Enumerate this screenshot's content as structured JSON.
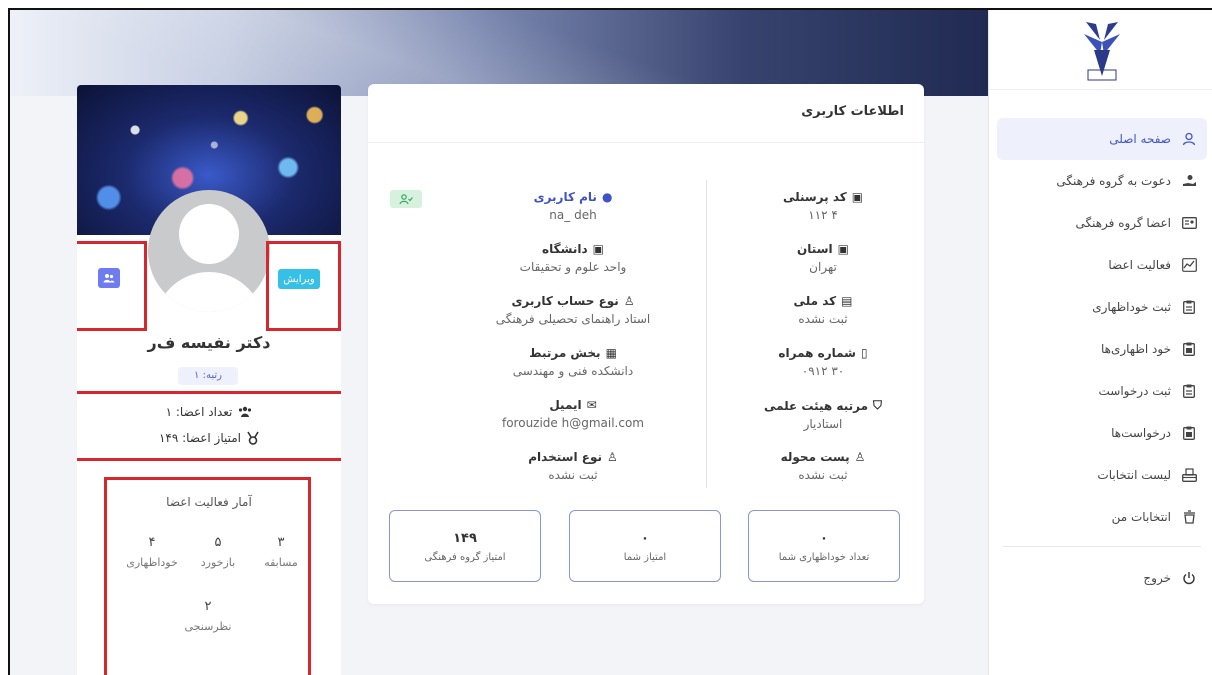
{
  "sidebar": {
    "items": [
      {
        "label": "صفحه اصلی",
        "icon": "user-icon",
        "active": true
      },
      {
        "label": "دعوت به گروه فرهنگی",
        "icon": "hand-invite-icon"
      },
      {
        "label": "اعضا گروه فرهنگی",
        "icon": "id-card-icon"
      },
      {
        "label": "فعالیت اعضا",
        "icon": "activity-chart-icon"
      },
      {
        "label": "ثبت خوداظهاری",
        "icon": "clipboard-icon"
      },
      {
        "label": "خود اظهاری‌ها",
        "icon": "clipboard-list-icon"
      },
      {
        "label": "ثبت درخواست",
        "icon": "clipboard-icon"
      },
      {
        "label": "درخواست‌ها",
        "icon": "clipboard-list-icon"
      },
      {
        "label": "لیست انتخابات",
        "icon": "ballot-box-icon"
      },
      {
        "label": "انتخابات من",
        "icon": "ballot-icon"
      }
    ],
    "logout": "خروج"
  },
  "profile": {
    "name": "دکتر نفیسه ف‌ر‌‌‌",
    "rank": "رتبه: ۱",
    "edit_label": "ویرایش",
    "members_count": "تعداد اعضا: ۱",
    "members_score": "امتیاز اعضا: ۱۴۹",
    "stats_title": "آمار فعالیت اعضا",
    "stats": [
      {
        "num": "۳",
        "label": "مسابقه"
      },
      {
        "num": "۵",
        "label": "بازخورد"
      },
      {
        "num": "۴",
        "label": "خوداظهاری"
      },
      {
        "num": "۲",
        "label": "نظرسنجی"
      }
    ]
  },
  "info": {
    "title": "اطلاعات کاربری",
    "right_col": [
      {
        "label": "کد پرسنلی",
        "value": "۱۱۲ ۴",
        "icon": "id-badge-icon"
      },
      {
        "label": "استان",
        "value": "تهران",
        "icon": "id-badge-icon"
      },
      {
        "label": "کد ملی",
        "value": "ثبت نشده",
        "icon": "id-card-icon"
      },
      {
        "label": "شماره همراه",
        "value": "۰۹۱۲ ۳۰",
        "icon": "mobile-icon"
      },
      {
        "label": "مرتبه هیئت علمی",
        "value": "استادیار",
        "icon": "academic-icon"
      },
      {
        "label": "پست محوله",
        "value": "ثبت نشده",
        "icon": "user-edit-icon"
      }
    ],
    "left_col": [
      {
        "label": "نام کاربری",
        "value": "na_ deh",
        "icon": "user-icon"
      },
      {
        "label": "دانشگاه",
        "value": "واحد علوم و تحقیقات",
        "icon": "id-badge-icon"
      },
      {
        "label": "نوع حساب کاربری",
        "value": "استاد راهنمای تحصیلی فرهنگی",
        "icon": "user-gear-icon"
      },
      {
        "label": "بخش مرتبط",
        "value": "دانشکده فنی و مهندسی",
        "icon": "building-icon"
      },
      {
        "label": "ایمیل",
        "value": "forouzide h@gmail.com",
        "icon": "mail-icon"
      },
      {
        "label": "نوع استخدام",
        "value": "ثبت نشده",
        "icon": "user-plus-icon"
      }
    ],
    "boxes": [
      {
        "num": "۰",
        "label": "تعداد خوداظهاری شما"
      },
      {
        "num": "۰",
        "label": "امتیاز شما"
      },
      {
        "num": "۱۴۹",
        "label": "امتیاز گروه فرهنگی"
      }
    ]
  },
  "colors": {
    "accent": "#4355c9",
    "edit_button": "#36c0e6",
    "highlight_box": "#d8262f"
  }
}
